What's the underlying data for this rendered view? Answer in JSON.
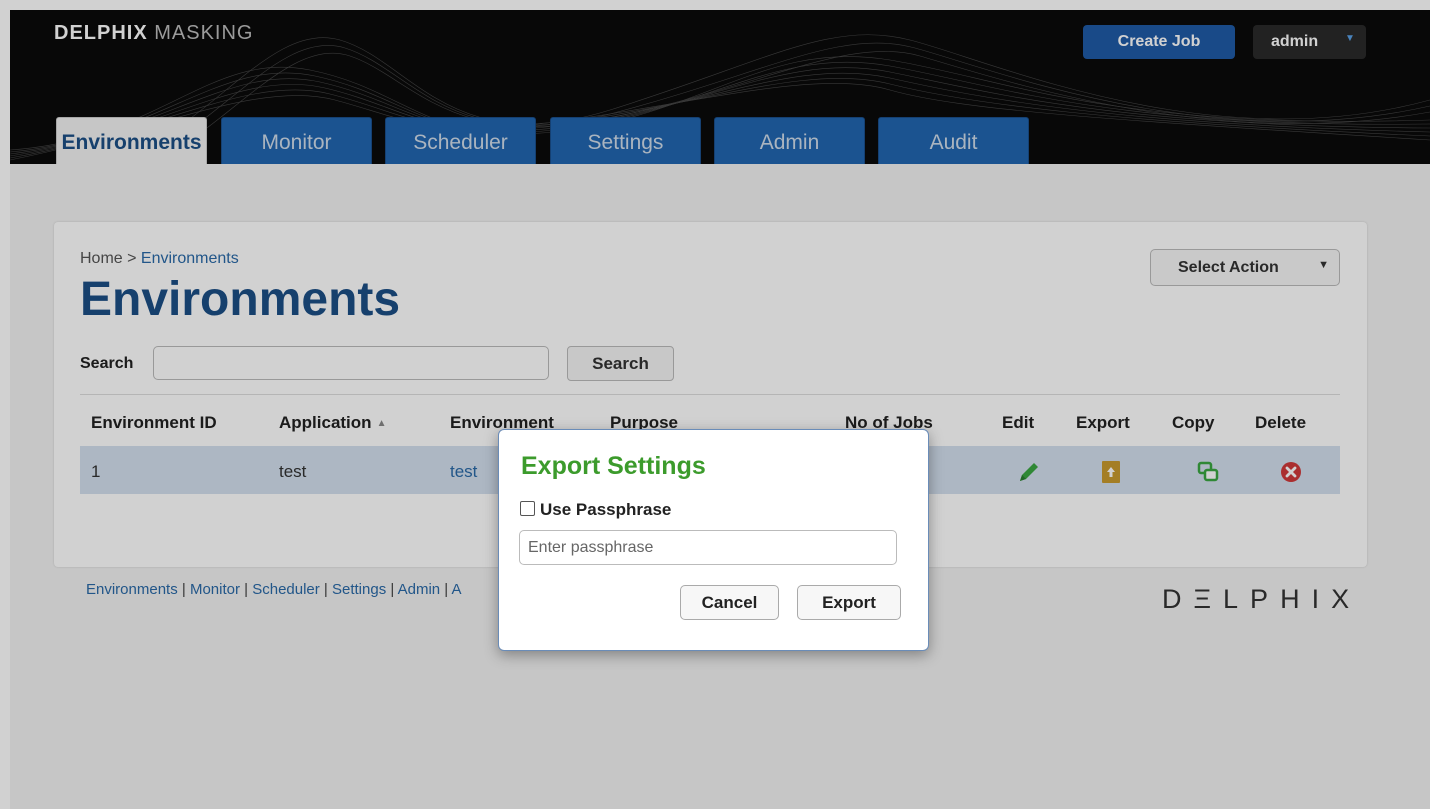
{
  "header": {
    "logo_bold": "DELPHIX",
    "logo_light": "MASKING",
    "create_job": "Create Job",
    "user": "admin"
  },
  "tabs": [
    {
      "label": "Environments",
      "active": true
    },
    {
      "label": "Monitor"
    },
    {
      "label": "Scheduler"
    },
    {
      "label": "Settings"
    },
    {
      "label": "Admin"
    },
    {
      "label": "Audit"
    }
  ],
  "breadcrumb": {
    "home": "Home",
    "sep": " > ",
    "current": "Environments"
  },
  "page_title": "Environments",
  "search": {
    "label": "Search",
    "button": "Search",
    "value": ""
  },
  "select_action": "Select Action",
  "table": {
    "headers": [
      "Environment ID",
      "Application",
      "Environment",
      "Purpose",
      "No of Jobs",
      "Edit",
      "Export",
      "Copy",
      "Delete"
    ],
    "rows": [
      {
        "id": "1",
        "application": "test",
        "environment": "test"
      }
    ]
  },
  "footer": {
    "links": [
      "Environments",
      "Monitor",
      "Scheduler",
      "Settings",
      "Admin",
      "A"
    ],
    "brand": "DΞLPHIX"
  },
  "modal": {
    "title": "Export Settings",
    "checkbox_label": "Use Passphrase",
    "passphrase_placeholder": "Enter passphrase",
    "cancel": "Cancel",
    "export": "Export"
  },
  "colors": {
    "brand_blue": "#1c4f86",
    "tab_blue": "#2266b0",
    "modal_title_green": "#3c9b2c",
    "edit_green": "#3aa641",
    "export_gold": "#c99a2e",
    "delete_red": "#d0393a"
  },
  "icons": {
    "edit": "pencil-icon",
    "export": "export-file-icon",
    "copy": "copy-icon",
    "delete": "delete-circle-icon"
  }
}
